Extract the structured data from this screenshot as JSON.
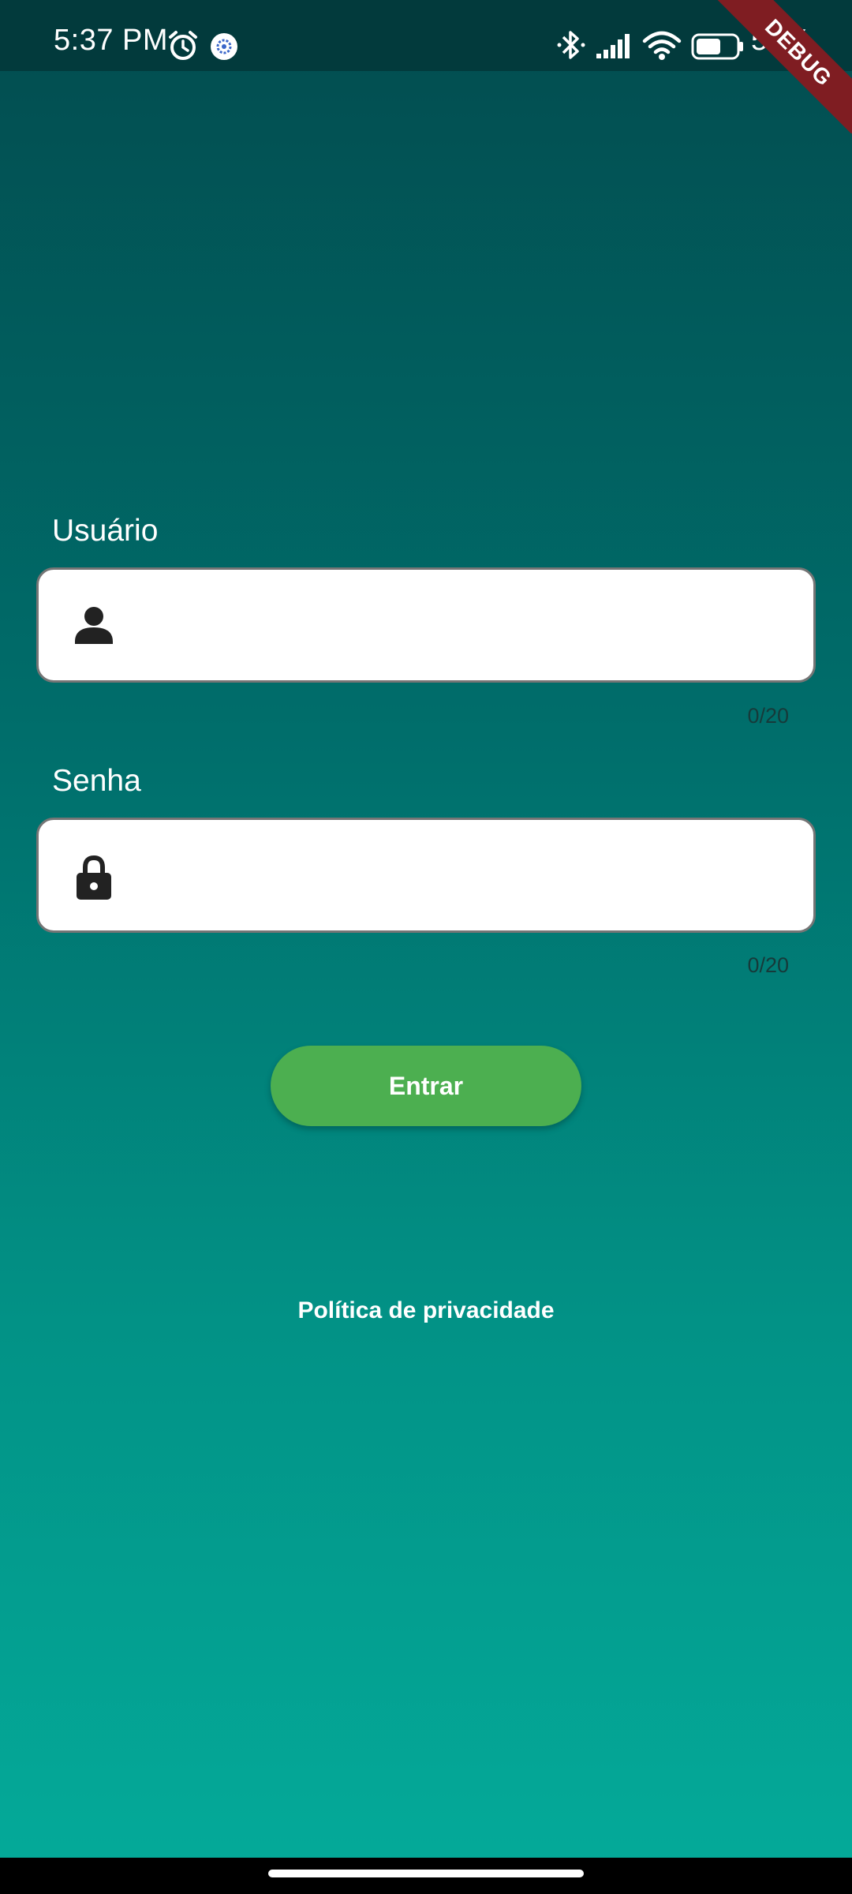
{
  "status_bar": {
    "time": "5:37 PM",
    "battery_text": "57%",
    "icons": [
      "alarm-icon",
      "settings-app-icon",
      "bluetooth-icon",
      "signal-icon",
      "wifi-icon",
      "battery-icon"
    ]
  },
  "debug_banner": "DEBUG",
  "form": {
    "username": {
      "label": "Usuário",
      "value": "",
      "counter": "0/20",
      "icon": "person-icon"
    },
    "password": {
      "label": "Senha",
      "value": "",
      "counter": "0/20",
      "icon": "lock-icon"
    },
    "submit_label": "Entrar"
  },
  "privacy_link": "Política de privacidade",
  "colors": {
    "accent_button": "#4caf50",
    "gradient_top": "#024c4f",
    "gradient_bottom": "#04ab9a",
    "debug_ribbon": "#7f1d22"
  }
}
